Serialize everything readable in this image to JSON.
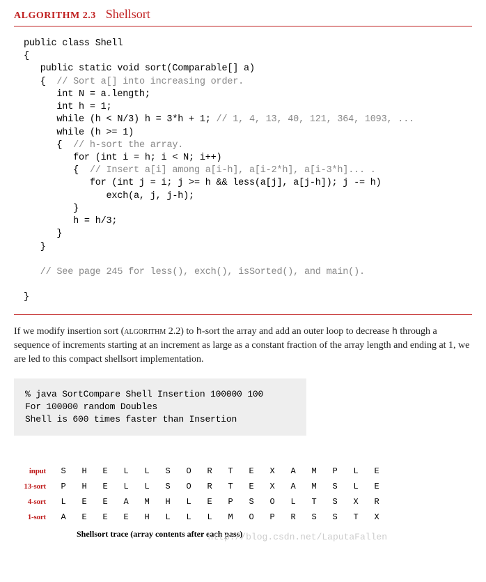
{
  "header": {
    "label": "ALGORITHM 2.3",
    "title": "Shellsort"
  },
  "code": {
    "l1": "public class Shell",
    "l2": "{",
    "l3": "   public static void sort(Comparable[] a)",
    "l4a": "   {  ",
    "l4c": "// Sort a[] into increasing order.",
    "l5": "      int N = a.length;",
    "l6": "      int h = 1;",
    "l7a": "      while (h < N/3) h = 3*h + 1; ",
    "l7c": "// 1, 4, 13, 40, 121, 364, 1093, ...",
    "l8": "      while (h >= 1)",
    "l9a": "      {  ",
    "l9c": "// h-sort the array.",
    "l10": "         for (int i = h; i < N; i++)",
    "l11a": "         {  ",
    "l11c": "// Insert a[i] among a[i-h], a[i-2*h], a[i-3*h]... .",
    "l12": "            for (int j = i; j >= h && less(a[j], a[j-h]); j -= h)",
    "l13": "               exch(a, j, j-h);",
    "l14": "         }",
    "l15": "         h = h/3;",
    "l16": "      }",
    "l17": "   }",
    "l18c": "   // See page 245 for less(), exch(), isSorted(), and main().",
    "l19": "}"
  },
  "body": {
    "part1": "If we modify insertion sort (",
    "smallcaps": "algorithm 2.2",
    "part2": ") to ",
    "mono1": "h",
    "part3": "-sort the array and add an outer loop to decrease ",
    "mono2": "h",
    "part4": " through a sequence of increments starting at an increment as large as a constant fraction of the array length and ending at 1, we are led to this compact shellsort implementation."
  },
  "output": {
    "l1": "% java SortCompare Shell Insertion 100000 100",
    "l2": "For 100000 random Doubles",
    "l3": "  Shell is 600 times faster than Insertion"
  },
  "trace": {
    "rows": [
      {
        "label": "input",
        "cells": [
          "S",
          "H",
          "E",
          "L",
          "L",
          "S",
          "O",
          "R",
          "T",
          "E",
          "X",
          "A",
          "M",
          "P",
          "L",
          "E"
        ]
      },
      {
        "label": "13-sort",
        "cells": [
          "P",
          "H",
          "E",
          "L",
          "L",
          "S",
          "O",
          "R",
          "T",
          "E",
          "X",
          "A",
          "M",
          "S",
          "L",
          "E"
        ]
      },
      {
        "label": "4-sort",
        "cells": [
          "L",
          "E",
          "E",
          "A",
          "M",
          "H",
          "L",
          "E",
          "P",
          "S",
          "O",
          "L",
          "T",
          "S",
          "X",
          "R"
        ]
      },
      {
        "label": "1-sort",
        "cells": [
          "A",
          "E",
          "E",
          "E",
          "H",
          "L",
          "L",
          "L",
          "M",
          "O",
          "P",
          "R",
          "S",
          "S",
          "T",
          "X"
        ]
      }
    ],
    "caption": "Shellsort trace (array contents after each pass)"
  },
  "watermark": "http://blog.csdn.net/LaputaFallen"
}
